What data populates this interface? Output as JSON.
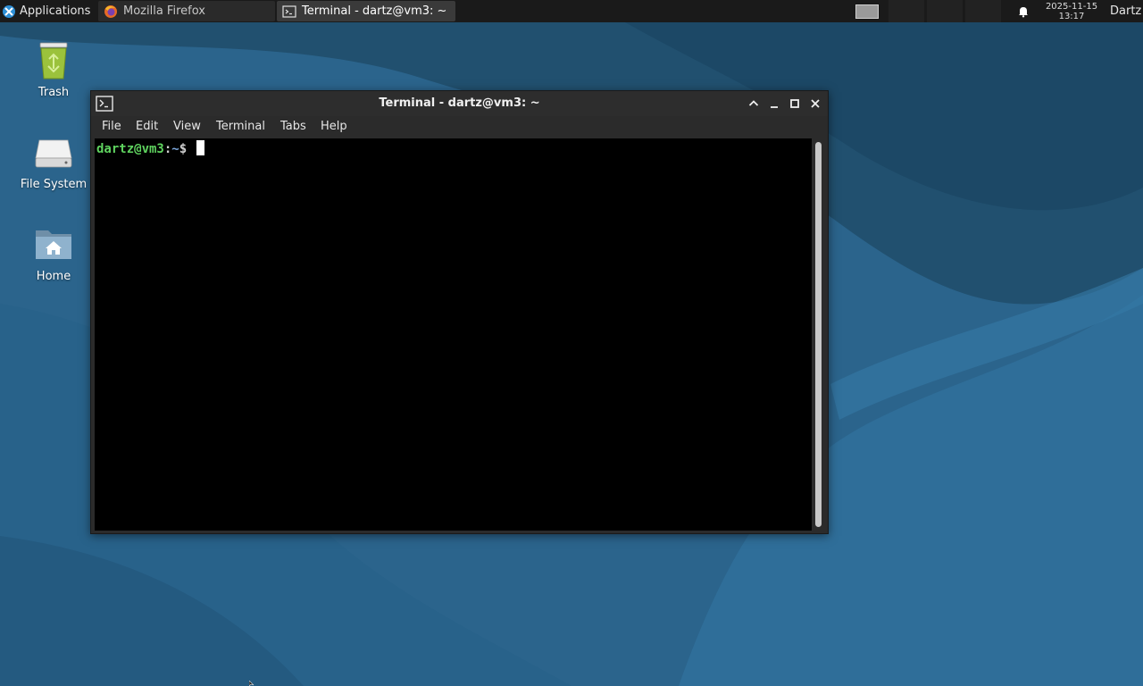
{
  "panel": {
    "apps_label": "Applications",
    "tasks": [
      {
        "label": "Mozilla Firefox",
        "icon": "firefox-icon"
      },
      {
        "label": "Terminal - dartz@vm3: ~",
        "icon": "terminal-icon"
      }
    ],
    "clock_date": "2025-11-15",
    "clock_time": "13:17",
    "user": "Dartz"
  },
  "desktop_icons": [
    {
      "label": "Trash",
      "icon": "trash-icon"
    },
    {
      "label": "File System",
      "icon": "drive-icon"
    },
    {
      "label": "Home",
      "icon": "home-folder-icon"
    }
  ],
  "window": {
    "title": "Terminal - dartz@vm3: ~",
    "menu": [
      "File",
      "Edit",
      "View",
      "Terminal",
      "Tabs",
      "Help"
    ],
    "prompt_user": "dartz@vm3",
    "prompt_sep": ":",
    "prompt_path": "~",
    "prompt_symbol": "$"
  },
  "colors": {
    "desktop_bg": "#2a5f86",
    "panel_bg": "#1a1a1a",
    "prompt_user": "#5fd35f",
    "terminal_bg": "#000000"
  }
}
